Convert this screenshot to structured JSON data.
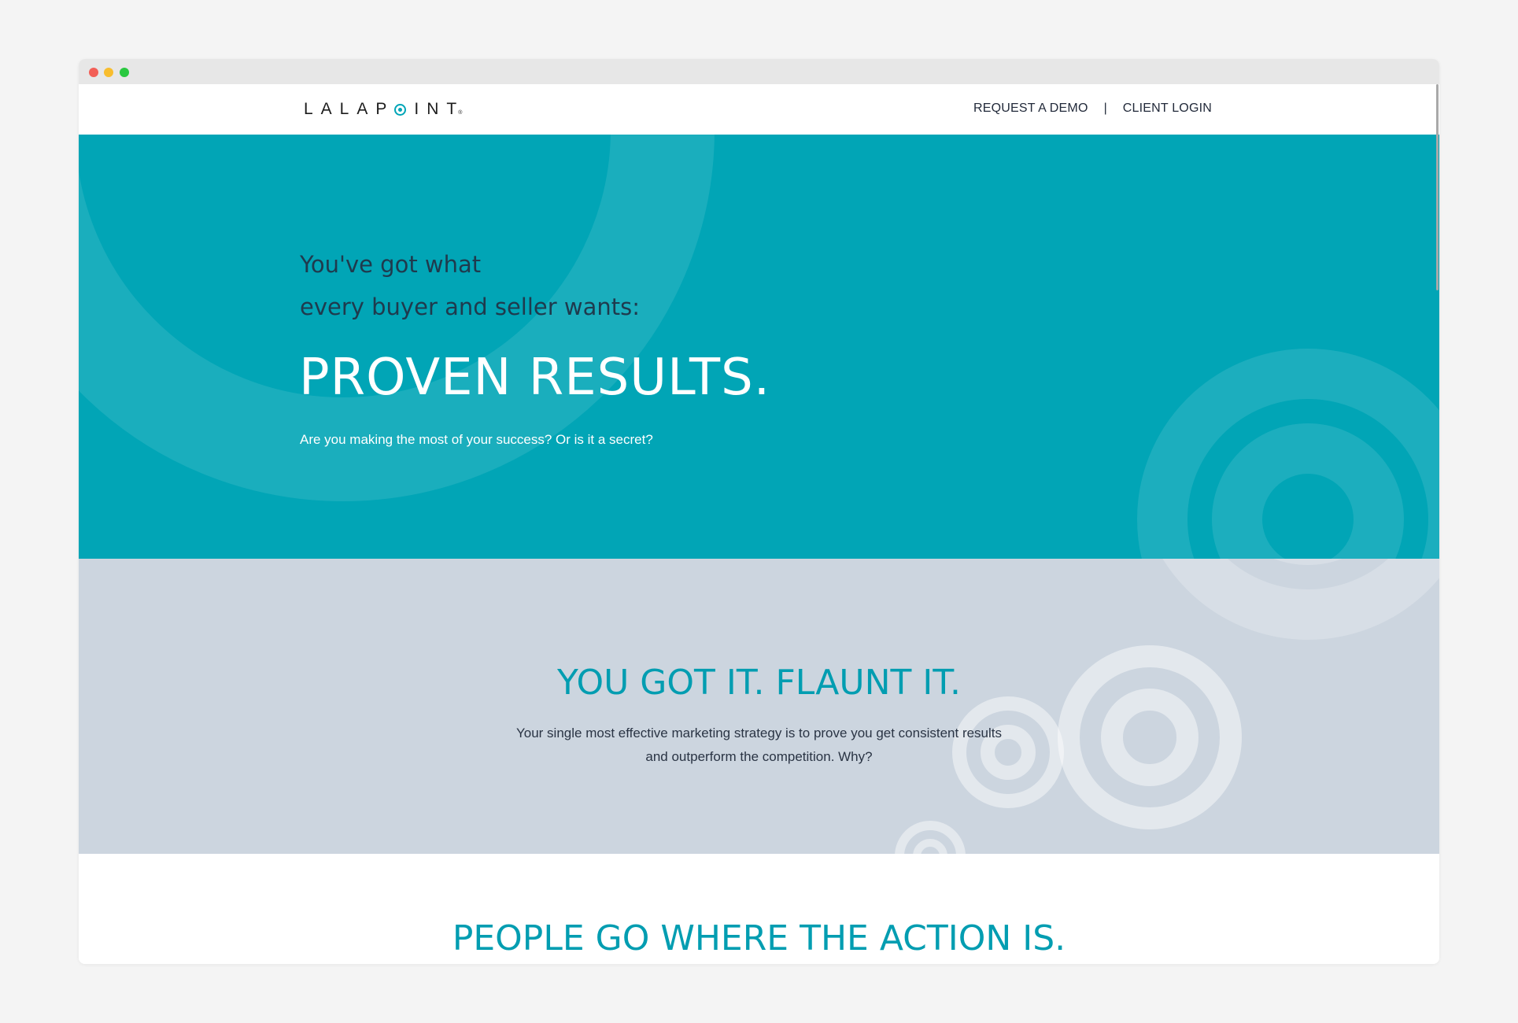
{
  "window": {
    "traffic_lights": [
      "close",
      "minimize",
      "maximize"
    ]
  },
  "header": {
    "logo": "LALAPOINT",
    "logo_mark": "®",
    "nav": {
      "request_demo": "REQUEST A DEMO",
      "separator": "|",
      "client_login": "CLIENT LOGIN"
    }
  },
  "hero": {
    "lead_line1": "You've got what",
    "lead_line2": "every buyer and seller wants:",
    "title": "PROVEN RESULTS.",
    "subtitle": "Are you making the most of your success? Or is it a secret?"
  },
  "flaunt": {
    "title": "YOU GOT IT. FLAUNT IT.",
    "body_line1": "Your single most effective marketing strategy is to prove you get consistent results",
    "body_line2": "and outperform the competition. Why?"
  },
  "action": {
    "title": "PEOPLE GO WHERE THE ACTION IS."
  },
  "colors": {
    "teal": "#01a5b6",
    "teal_text": "#029db1",
    "grey_blue": "#ccd5df",
    "navy": "#1f3a4d"
  }
}
